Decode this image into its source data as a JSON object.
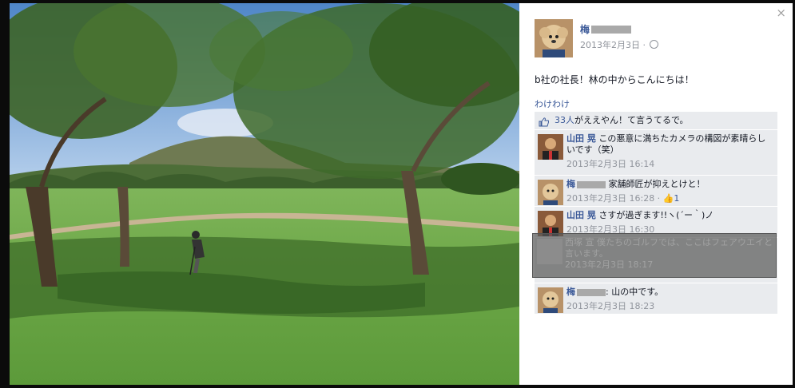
{
  "panel": {
    "close_icon": "×",
    "post": {
      "author": "梅",
      "date": "2013年2月3日 ·",
      "text": "b社の社長！林の中からこんにちは！",
      "link": "わけわけ",
      "privacy_icon": "globe-icon"
    },
    "likes": {
      "count": "33人",
      "text": "がええやん！て言うてるで。"
    },
    "comments": [
      {
        "author": "山田 晃",
        "text": "この悪意に満ちたカメラの構図が素晴らしいです（笑）",
        "date": "2013年2月3日 16:14",
        "likes": ""
      },
      {
        "author": "梅",
        "text": "家舗師匠が抑えとけと！",
        "date": "2013年2月3日 16:28 ·",
        "likes": "1"
      },
      {
        "author": "山田 晃",
        "text": "さすが過ぎます!!ヽ(´ー｀)ノ",
        "date": "2013年2月3日 16:30",
        "likes": ""
      },
      {
        "author": "梅",
        "text": "山の中です。",
        "date": "2013年2月3日 18:23",
        "likes": ""
      }
    ],
    "hidden_comment": {
      "text": "西塚 宣 僕たちのゴルフでは、ここはフェアウエイと言います。",
      "date": "2013年2月3日 18:17"
    }
  },
  "colors": {
    "link": "#3b5998",
    "comment_bg": "#e9ebee",
    "meta": "#90949c",
    "backdrop": "#0b0b0b"
  }
}
